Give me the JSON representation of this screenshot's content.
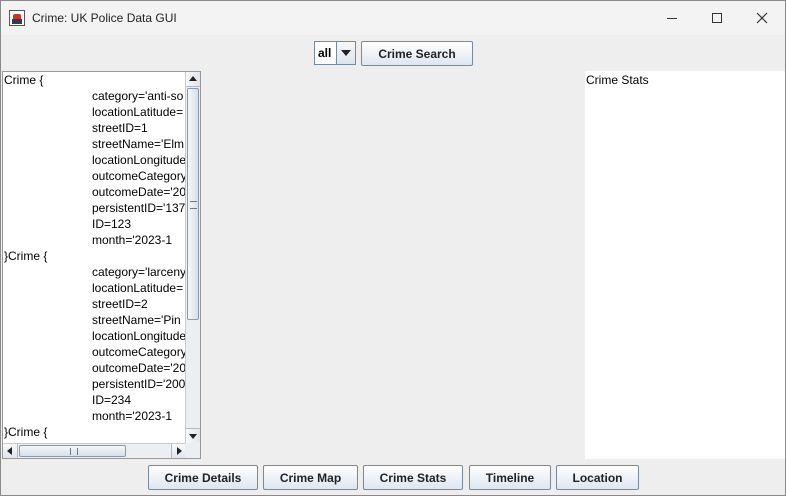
{
  "window": {
    "title": "Crime: UK Police Data GUI"
  },
  "toolbar": {
    "filter_value": "all",
    "search_label": "Crime Search"
  },
  "crime_list": {
    "lines": [
      {
        "text": "Crime {",
        "indent": false
      },
      {
        "text": "category='anti-so",
        "indent": true
      },
      {
        "text": "locationLatitude=",
        "indent": true
      },
      {
        "text": "streetID=1",
        "indent": true
      },
      {
        "text": "streetName='Elm",
        "indent": true
      },
      {
        "text": "locationLongitude",
        "indent": true
      },
      {
        "text": "outcomeCategory",
        "indent": true
      },
      {
        "text": "outcomeDate='20",
        "indent": true
      },
      {
        "text": "persistentID='137",
        "indent": true
      },
      {
        "text": "ID=123",
        "indent": true
      },
      {
        "text": "month='2023-1",
        "indent": true
      },
      {
        "text": "}Crime {",
        "indent": false
      },
      {
        "text": "category='larceny",
        "indent": true
      },
      {
        "text": "locationLatitude=",
        "indent": true
      },
      {
        "text": "streetID=2",
        "indent": true
      },
      {
        "text": "streetName='Pin",
        "indent": true
      },
      {
        "text": "locationLongitude",
        "indent": true
      },
      {
        "text": "outcomeCategory",
        "indent": true
      },
      {
        "text": "outcomeDate='20",
        "indent": true
      },
      {
        "text": "persistentID='200",
        "indent": true
      },
      {
        "text": "ID=234",
        "indent": true
      },
      {
        "text": "month='2023-1",
        "indent": true
      },
      {
        "text": "}Crime {",
        "indent": false
      }
    ]
  },
  "stats": {
    "title": "Crime Stats"
  },
  "bottom_buttons": {
    "details": "Crime Details",
    "map": "Crime Map",
    "stats": "Crime Stats",
    "timeline": "Timeline",
    "location": "Location"
  },
  "icons": {
    "app": "java-app-icon",
    "minimize": "minimize-icon",
    "maximize": "maximize-icon",
    "close": "close-icon"
  }
}
